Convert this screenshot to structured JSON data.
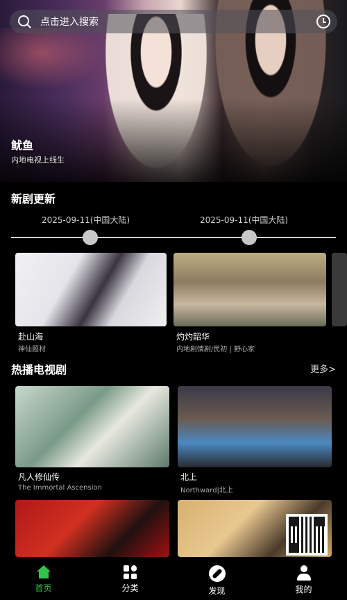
{
  "search": {
    "placeholder": "点击进入搜索"
  },
  "hero": {
    "title": "鱿鱼",
    "subtitle": "内地电视上线生"
  },
  "new_section": {
    "title": "新剧更新"
  },
  "timeline": {
    "dates": [
      "2025-09-11(中国大陆)",
      "2025-09-11(中国大陆)"
    ]
  },
  "new_cards": [
    {
      "title": "赴山海",
      "subtitle": "神仙题材"
    },
    {
      "title": "灼灼韶华",
      "subtitle": "内地剧情剧/民初 | 野心家"
    }
  ],
  "hot_section": {
    "title": "热播电视剧",
    "more": "更多>"
  },
  "hot_cards": [
    {
      "title": "凡人修仙传",
      "subtitle": "The Immortal Ascension"
    },
    {
      "title": "北上",
      "subtitle": "Northward|北上"
    },
    {
      "title": "",
      "subtitle": ""
    },
    {
      "title": "",
      "subtitle": ""
    }
  ],
  "nav": {
    "items": [
      {
        "label": "首页",
        "icon": "home-icon",
        "active": true
      },
      {
        "label": "分类",
        "icon": "category-icon",
        "active": false
      },
      {
        "label": "发现",
        "icon": "compass-icon",
        "active": false
      },
      {
        "label": "我的",
        "icon": "user-icon",
        "active": false
      }
    ],
    "accent_color": "#33c24a"
  }
}
